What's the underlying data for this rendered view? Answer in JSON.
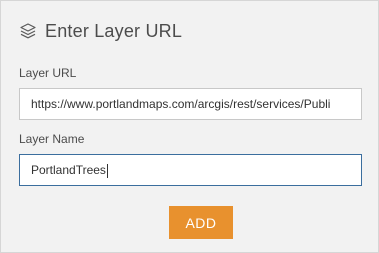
{
  "header": {
    "title": "Enter Layer URL",
    "icon": "layers-icon"
  },
  "form": {
    "url_label": "Layer URL",
    "url_value": "https://www.portlandmaps.com/arcgis/rest/services/Publi",
    "name_label": "Layer Name",
    "name_value": "PortlandTrees",
    "add_label": "ADD"
  },
  "colors": {
    "panel_bg": "#f2f2f2",
    "accent": "#e8912e",
    "focus_border": "#3b6e9e"
  }
}
